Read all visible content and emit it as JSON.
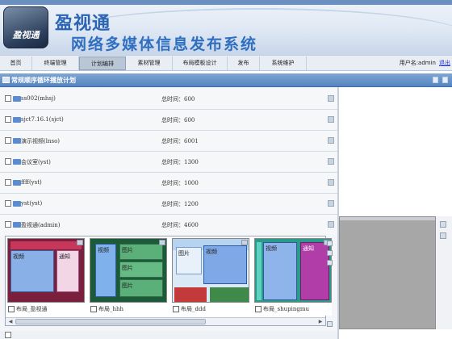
{
  "header": {
    "logo_text": "盈视通",
    "brand": "盈视通",
    "system_title": "网络多媒体信息发布系统"
  },
  "nav": {
    "tabs": [
      {
        "label": "首页",
        "active": false
      },
      {
        "label": "终端管理",
        "active": false
      },
      {
        "label": "计划编排",
        "active": true
      },
      {
        "label": "素材管理",
        "active": false
      },
      {
        "label": "布局模板设计",
        "active": false
      },
      {
        "label": "发布",
        "active": false
      },
      {
        "label": "系统维护",
        "active": false
      }
    ],
    "user_label": "用户名:admin",
    "logout": "退出"
  },
  "section": {
    "title": "常规顺序循环播放计划"
  },
  "plans": [
    {
      "name": "ss002(mhsj)",
      "total": "总时间：600"
    },
    {
      "name": "sjct7.16.1(sjct)",
      "total": "总时间：600"
    },
    {
      "name": "演示视频(lnso)",
      "total": "总时间：6001"
    },
    {
      "name": "会议室(yst)",
      "total": "总时间：1300"
    },
    {
      "name": "ffff(yst)",
      "total": "总时间：1000"
    },
    {
      "name": "yst(yst)",
      "total": "总时间：1200"
    },
    {
      "name": "盈视通(admin)",
      "total": "总时间：4600"
    }
  ],
  "layouts": [
    {
      "label": "布局_盈视通",
      "panels": [
        "视频",
        "通知"
      ]
    },
    {
      "label": "布局_hhh",
      "panels": [
        "视频",
        "图片",
        "图片",
        "图片"
      ]
    },
    {
      "label": "布局_ddd",
      "panels": [
        "图片",
        "视频"
      ]
    },
    {
      "label": "布局_shupingmu",
      "panels": [
        "视频",
        "通知"
      ]
    }
  ],
  "colors": {
    "section_bar": "#5484bf",
    "brand_blue": "#2c64b4",
    "right_panel": "#a7a7a7"
  }
}
